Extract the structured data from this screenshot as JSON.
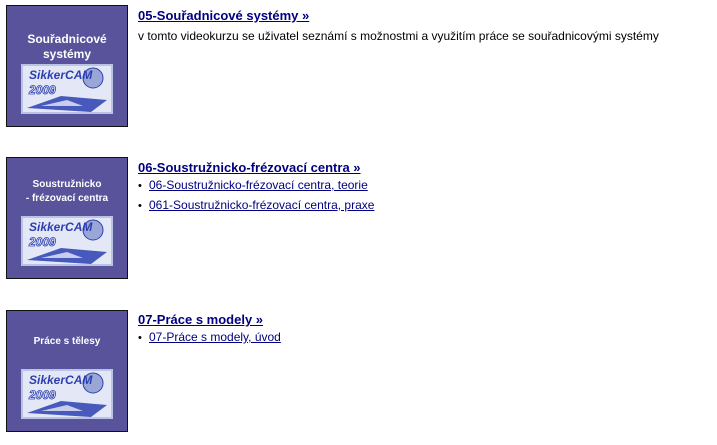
{
  "courses": [
    {
      "thumb_title": [
        "Souřadnicové",
        "systémy"
      ],
      "logo_text": "SikkerCAM",
      "logo_year": "2009",
      "title": "05-Souřadnicové systémy »",
      "description": "v tomto videokurzu se uživatel seznámí s možnostmi a využitím práce se souřadnicovými systémy",
      "lessons": []
    },
    {
      "thumb_title": [
        "Soustružnicko",
        "- frézovací centra"
      ],
      "logo_text": "SikkerCAM",
      "logo_year": "2009",
      "title": "06-Soustružnicko-frézovací centra »",
      "description": "",
      "lessons": [
        "06-Soustružnicko-frézovací centra, teorie",
        "061-Soustružnicko-frézovací centra, praxe"
      ]
    },
    {
      "thumb_title": [
        "Práce s tělesy"
      ],
      "logo_text": "SikkerCAM",
      "logo_year": "2009",
      "title": "07-Práce s modely »",
      "description": "",
      "lessons": [
        "07-Práce s modely, úvod"
      ]
    }
  ],
  "colors": {
    "thumb_background": "#58539a",
    "link": "#000080",
    "logo_blue": "#2c3fb0"
  }
}
